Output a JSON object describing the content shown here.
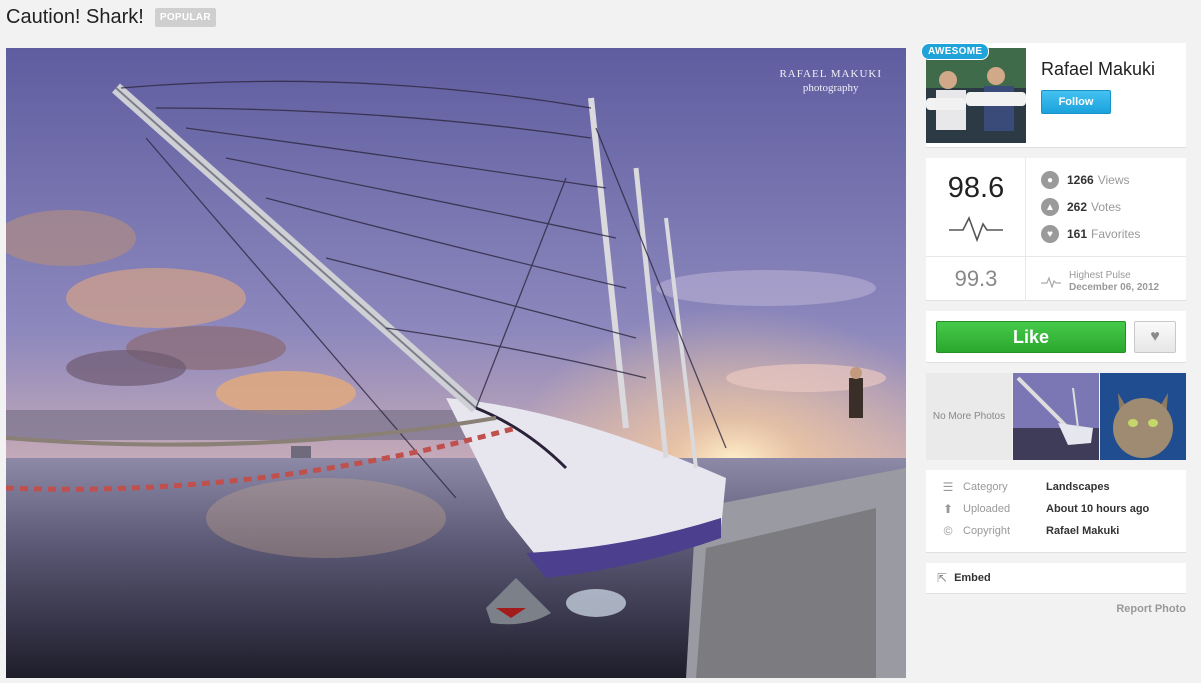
{
  "photo": {
    "title": "Caution! Shark!",
    "badge": "POPULAR",
    "watermark_line1": "RAFAEL MAKUKI",
    "watermark_line2": "photography"
  },
  "user": {
    "badge": "AWESOME",
    "name": "Rafael Makuki",
    "follow_label": "Follow"
  },
  "stats": {
    "pulse": "98.6",
    "highest_pulse_value": "99.3",
    "views_count": "1266",
    "views_label": "Views",
    "votes_count": "262",
    "votes_label": "Votes",
    "favorites_count": "161",
    "favorites_label": "Favorites",
    "highest_pulse_label": "Highest Pulse",
    "highest_pulse_date": "December 06, 2012"
  },
  "actions": {
    "like_label": "Like",
    "favorite_icon": "heart-icon"
  },
  "related": {
    "no_more_label": "No More Photos"
  },
  "meta": {
    "category_label": "Category",
    "category_value": "Landscapes",
    "uploaded_label": "Uploaded",
    "uploaded_value": "About 10 hours ago",
    "copyright_label": "Copyright",
    "copyright_value": "Rafael Makuki"
  },
  "embed": {
    "label": "Embed"
  },
  "report": {
    "label": "Report Photo"
  },
  "colors": {
    "follow": "#1aa2dc",
    "like": "#2aa82e",
    "awesome": "#1fa3d9"
  }
}
